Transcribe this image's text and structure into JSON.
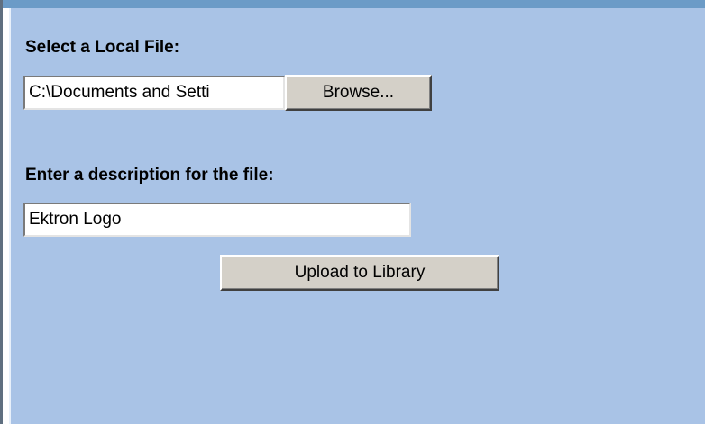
{
  "form": {
    "file_label": "Select a Local File:",
    "file_value": "C:\\Documents and Setti",
    "browse_label": "Browse...",
    "description_label": "Enter a description for the file:",
    "description_value": "Ektron Logo",
    "upload_label": "Upload to Library"
  },
  "colors": {
    "panel_background": "#a9c3e6",
    "top_bar": "#6b9bc7",
    "button_face": "#d4d0c8"
  }
}
